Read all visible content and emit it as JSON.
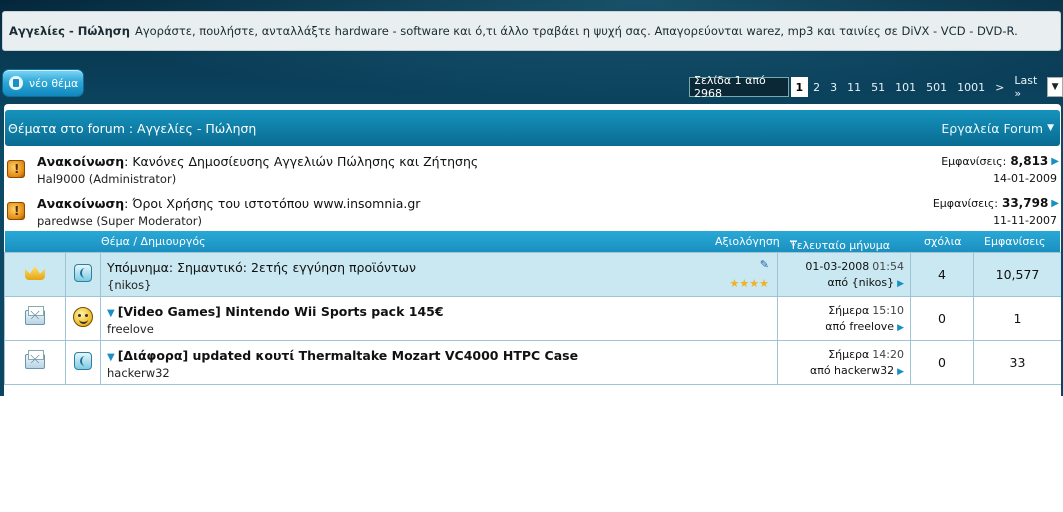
{
  "forum_description": {
    "name": "Αγγελίες - Πώληση",
    "text": "Αγοράστε, πουλήστε, ανταλλάξτε hardware - software και ό,τι άλλο τραβάει η ψυχή σας. Απαγορεύονται warez, mp3 και ταινίες σε DiVX - VCD - DVD-R."
  },
  "new_thread_label": "νέο θέμα",
  "pagination": {
    "label": "Σελίδα 1 από 2968",
    "current": "1",
    "pages": [
      "2",
      "3",
      "11",
      "51",
      "101",
      "501",
      "1001"
    ],
    "next": ">",
    "last": "Last »",
    "menu_icon": "chevron-down-icon"
  },
  "forum_header": {
    "title": "Θέματα στο forum : Αγγελίες - Πώληση",
    "tools": "Εργαλεία Forum",
    "tools_icon": "chevron-down-icon"
  },
  "announcements": [
    {
      "label": "Ανακοίνωση",
      "title": "Κανόνες Δημοσίευσης Αγγελιών Πώλησης και Ζήτησης",
      "author": "Hal9000 (Administrator)",
      "views_label": "Εμφανίσεις:",
      "views": "8,813",
      "date": "14-01-2009"
    },
    {
      "label": "Ανακοίνωση",
      "title": "Όροι Χρήσης του ιστοτόπου www.insomnia.gr",
      "author": "paredwse (Super Moderator)",
      "views_label": "Εμφανίσεις:",
      "views": "33,798",
      "date": "11-11-2007"
    }
  ],
  "columns": {
    "topic": "Θέμα / Δημιουργός",
    "rating": "Αξιολόγηση",
    "last_post": "Τελευταίο μήνυμα",
    "comments": "σχόλια",
    "views": "Εμφανίσεις"
  },
  "threads": [
    {
      "status_icon": "crown-icon",
      "topic_icon": "thread-icon",
      "title": "Υπόμνημα: Σημαντικό: 2ετής εγγύηση προϊόντων",
      "author": "{nikos}",
      "rating_stars": 4,
      "last_date": "01-03-2008",
      "last_time": "01:54",
      "last_by": "από {nikos}",
      "comments": "4",
      "views": "10,577"
    },
    {
      "status_icon": "envelope-icon",
      "topic_icon": "smiley-icon",
      "title": "[Video Games] Nintendo Wii Sports pack 145€",
      "author": "freelove",
      "last_date": "Σήμερα",
      "last_time": "15:10",
      "last_by": "από freelove",
      "comments": "0",
      "views": "1"
    },
    {
      "status_icon": "envelope-icon",
      "topic_icon": "thread-icon",
      "title": "[Διάφορα] updated κουτί Thermaltake Mozart VC4000 HTPC Case",
      "author": "hackerw32",
      "last_date": "Σήμερα",
      "last_time": "14:20",
      "last_by": "από hackerw32",
      "comments": "0",
      "views": "33"
    }
  ]
}
